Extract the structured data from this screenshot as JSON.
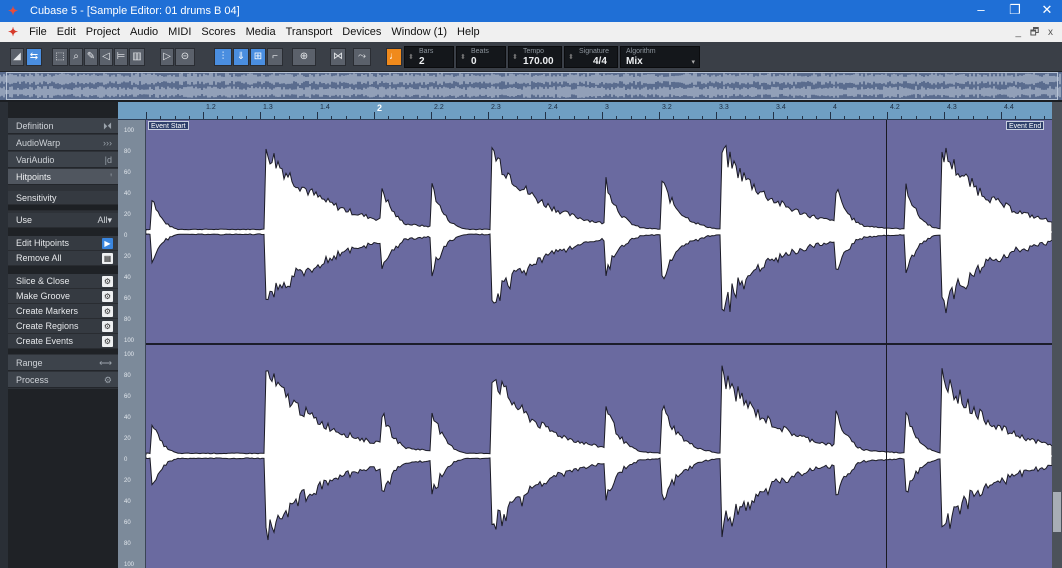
{
  "window": {
    "title": "Cubase 5 - [Sample Editor: 01 drums B 04]",
    "controls": [
      "–",
      "❐",
      "✕"
    ]
  },
  "menu": [
    "File",
    "Edit",
    "Project",
    "Audio",
    "MIDI",
    "Scores",
    "Media",
    "Transport",
    "Devices",
    "Window (1)",
    "Help"
  ],
  "menu_right": "_ 🗗 x",
  "toolbar": {
    "fields": {
      "bars": {
        "label": "Bars",
        "value": "2"
      },
      "beats": {
        "label": "Beats",
        "value": "0"
      },
      "tempo": {
        "label": "Tempo",
        "value": "170.00"
      },
      "signature": {
        "label": "Signature",
        "value": "4/4"
      },
      "algorithm": {
        "label": "Algorithm",
        "value": "Mix"
      }
    }
  },
  "inspector": {
    "sections": [
      {
        "label": "Definition",
        "icon": "⏵⏴"
      },
      {
        "label": "AudioWarp",
        "icon": "›››"
      },
      {
        "label": "VariAudio",
        "icon": "|d"
      },
      {
        "label": "Hitpoints",
        "icon": "ꞌ"
      }
    ],
    "hitpoints": {
      "sensitivity_label": "Sensitivity",
      "use_label": "Use",
      "use_value": "All",
      "edit_hitpoints": "Edit Hitpoints",
      "remove_all": "Remove All",
      "actions": [
        "Slice & Close",
        "Make Groove",
        "Create Markers",
        "Create Regions",
        "Create Events"
      ]
    },
    "range_label": "Range",
    "process_label": "Process"
  },
  "ruler": {
    "labels": [
      "1.2",
      "1.3",
      "1.4",
      "2",
      "2.2",
      "2.3",
      "2.4",
      "3",
      "3.2",
      "3.3",
      "3.4",
      "4",
      "4.2",
      "4.3",
      "4.4"
    ],
    "big_label": "2"
  },
  "scale_labels": [
    "100",
    "80",
    "60",
    "40",
    "20",
    "0",
    "20",
    "40",
    "60",
    "80",
    "100"
  ],
  "events": {
    "start": "Event Start",
    "end": "Event End"
  },
  "colors": {
    "waveform_bg": "#6a6aa0",
    "ruler": "#6f9fc3",
    "titlebar": "#1f6fd6",
    "accent_orange": "#f08a1c"
  }
}
